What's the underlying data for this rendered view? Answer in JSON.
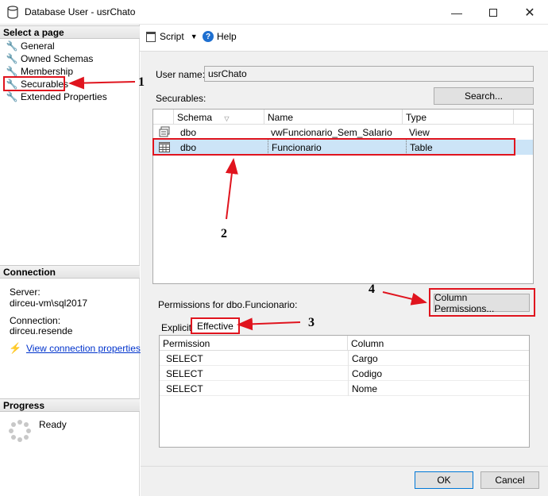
{
  "window": {
    "title": "Database User - usrChato"
  },
  "left_pane": {
    "select_page_header": "Select a page",
    "pages": [
      "General",
      "Owned Schemas",
      "Membership",
      "Securables",
      "Extended Properties"
    ],
    "connection_header": "Connection",
    "server_label": "Server:",
    "server_value": "dirceu-vm\\sql2017",
    "connection_label": "Connection:",
    "connection_value": "dirceu.resende",
    "view_props_link": "View connection properties",
    "progress_header": "Progress",
    "progress_status": "Ready"
  },
  "toolbar": {
    "script_label": "Script",
    "help_label": "Help"
  },
  "form": {
    "user_name_label": "User name:",
    "user_name_value": "usrChato",
    "securables_label": "Securables:",
    "search_button": "Search...",
    "permissions_for_label": "Permissions for dbo.Funcionario:",
    "column_permissions_button": "Column Permissions..."
  },
  "securables_table": {
    "headers": [
      "Schema",
      "Name",
      "Type"
    ],
    "rows": [
      {
        "schema": "dbo",
        "name": "vwFuncionario_Sem_Salario",
        "type": "View",
        "icon": "view-icon"
      },
      {
        "schema": "dbo",
        "name": "Funcionario",
        "type": "Table",
        "icon": "table-icon"
      }
    ]
  },
  "tabs": [
    "Explicit",
    "Effective"
  ],
  "permissions_table": {
    "headers": [
      "Permission",
      "Column"
    ],
    "rows": [
      {
        "permission": "SELECT",
        "column": "Cargo"
      },
      {
        "permission": "SELECT",
        "column": "Codigo"
      },
      {
        "permission": "SELECT",
        "column": "Nome"
      }
    ]
  },
  "buttons": {
    "ok": "OK",
    "cancel": "Cancel"
  },
  "annotations": [
    "1",
    "2",
    "3",
    "4"
  ],
  "colors": {
    "annotation_red": "#e0141e",
    "selection": "#cce4f7",
    "link": "#0033cc"
  }
}
